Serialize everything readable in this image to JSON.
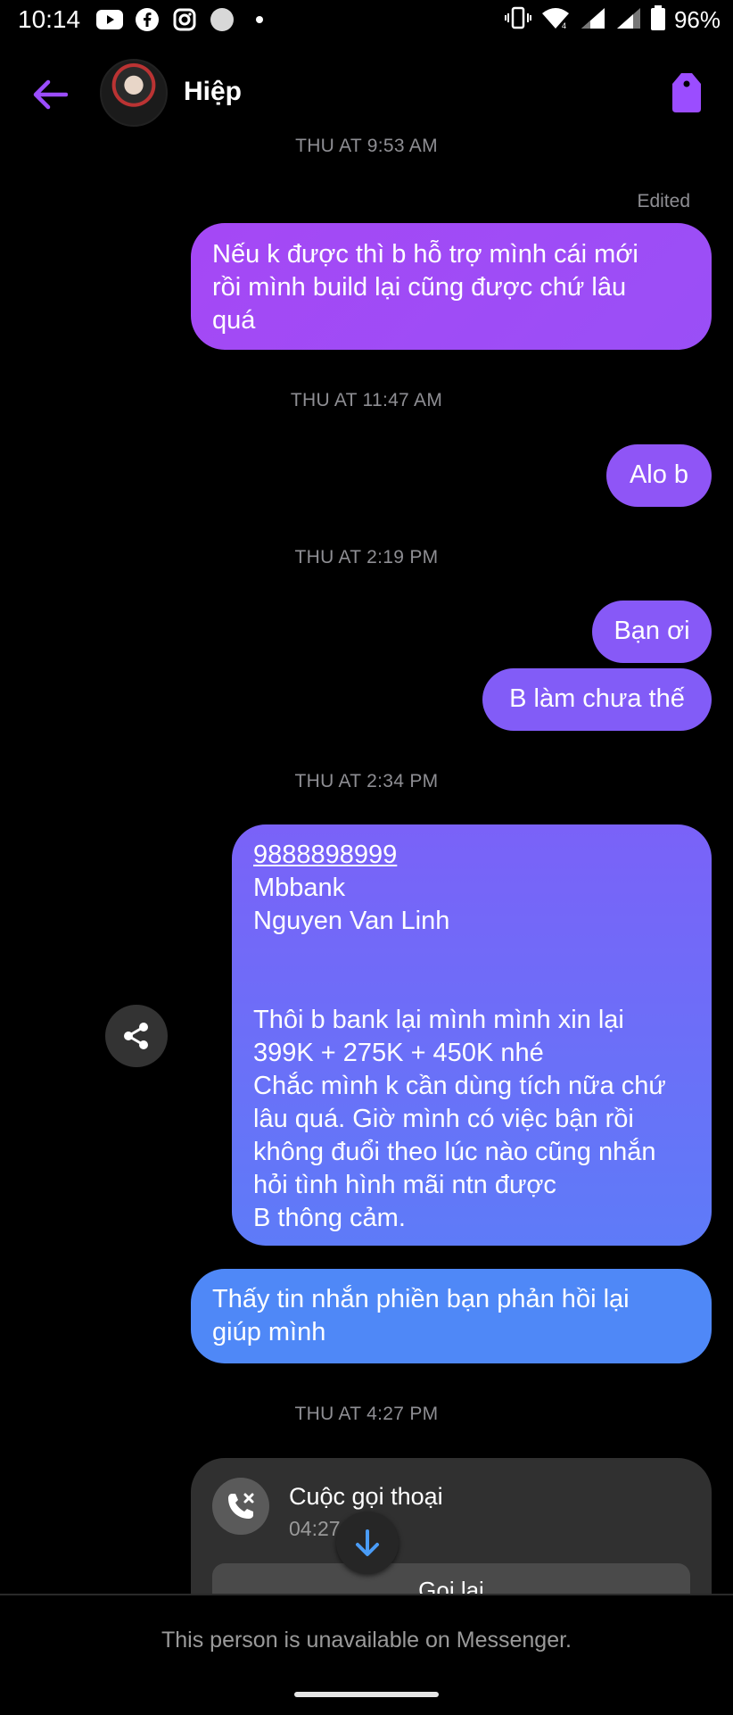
{
  "status_bar": {
    "time": "10:14",
    "battery": "96%",
    "apps": [
      "youtube-icon",
      "facebook-icon",
      "instagram-icon",
      "circle-icon",
      "dot-icon"
    ]
  },
  "header": {
    "contact_name": "Hiệp",
    "accent_color": "#9b4dff"
  },
  "conversation": {
    "ts_1": "THU AT 9:53 AM",
    "edited_label": "Edited",
    "msg_1": [
      "Nếu k được thì b hỗ trợ mình cái mới",
      "rồi mình build lại cũng được chứ lâu",
      "quá"
    ],
    "ts_2": "THU AT 11:47 AM",
    "msg_2": "Alo b",
    "ts_3": "THU AT 2:19 PM",
    "msg_3": "Bạn ơi",
    "msg_4": "B làm chưa thế",
    "ts_4": "THU AT 2:34 PM",
    "msg_5": {
      "account_number": "9888898999",
      "lines_a": [
        "Mbbank",
        "Nguyen Van Linh"
      ],
      "lines_b": [
        "Thôi b bank lại mình mình xin lại",
        "399K + 275K + 450K nhé",
        "Chắc mình k cần dùng tích nữa chứ",
        "lâu quá. Giờ mình có việc bận rồi",
        "không đuổi theo lúc nào cũng nhắn",
        "hỏi tình hình mãi ntn được",
        "B thông cảm."
      ]
    },
    "msg_6": [
      "Thấy tin nhắn phiền bạn phản hồi lại",
      "giúp mình"
    ],
    "ts_5": "THU AT 4:27 PM",
    "call": {
      "title": "Cuộc gọi thoại",
      "time": "04:27",
      "button": "Gọi lại"
    }
  },
  "footer": {
    "text": "This person is unavailable on Messenger."
  }
}
